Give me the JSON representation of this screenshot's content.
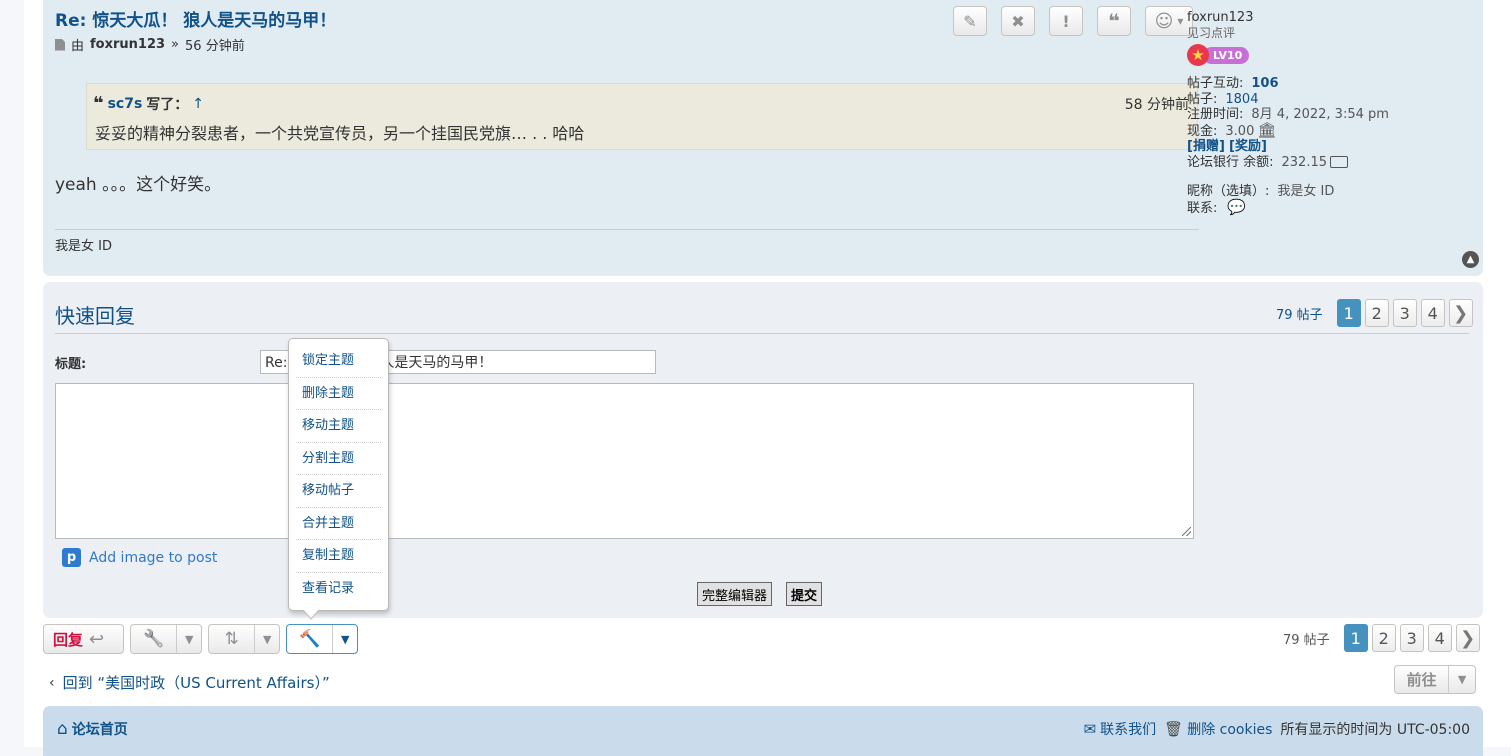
{
  "post": {
    "title": "Re: 惊天大瓜！ 狼人是天马的马甲！",
    "by_prefix": "由",
    "author": "foxrun123",
    "sep": "»",
    "time": "56 分钟前",
    "buttons": {
      "edit_icon": "✎",
      "delete_icon": "✖",
      "report_icon": "!",
      "quote_icon": "❝",
      "react_icon": "☺",
      "react_caret": "▾"
    },
    "quote": {
      "icon": "❝",
      "author": "sc7s",
      "wrote": "写了：",
      "up_arrow": "↑",
      "time": "58 分钟前",
      "body": "妥妥的精神分裂患者，一个共党宣传员，另一个挂国民党旗… .  .  哈哈"
    },
    "body": "yeah 。。。这个好笑。",
    "signature": "我是女 ID",
    "top_icon": "▲"
  },
  "profile": {
    "username": "foxrun123",
    "rank": "见习点评",
    "badge_star": "★",
    "badge_level": "LV10",
    "interactions_label": "帖子互动:",
    "interactions": "106",
    "posts_label": "帖子:",
    "posts": "1804",
    "joined_label": "注册时间:",
    "joined": "8月 4, 2022, 3:54 pm",
    "cash_label": "现金:",
    "cash": "3.00",
    "bank_icon": "🏛",
    "donate": "[捐赠]",
    "reward": "[奖励]",
    "bank_label": "论坛银行 余额:",
    "bank_balance": "232.15",
    "nickname_label": "昵称（选填）:",
    "nickname": "我是女 ID",
    "contact_label": "联系:",
    "contact_icon": "💬"
  },
  "quick_reply": {
    "title": "快速回复",
    "post_count": "79 帖子",
    "pages": [
      "1",
      "2",
      "3",
      "4"
    ],
    "next_icon": "❯",
    "subject_label": "标题:",
    "subject_value": "Re: 惊天大瓜！ 狼人是天马的马甲！",
    "add_image_icon": "p",
    "add_image": "Add image to post",
    "full_editor": "完整编辑器",
    "submit": "提交"
  },
  "mod_menu": {
    "items": [
      "锁定主题",
      "删除主题",
      "移动主题",
      "分割主题",
      "移动帖子",
      "合并主题",
      "复制主题",
      "查看记录"
    ]
  },
  "action_bar": {
    "reply_label": "回复",
    "reply_icon": "↩",
    "tools_icon": "🔧",
    "sort_icon": "⇅",
    "mod_icon": "🔨",
    "caret": "▼",
    "post_count": "79 帖子",
    "pages": [
      "1",
      "2",
      "3",
      "4"
    ],
    "next_icon": "❯"
  },
  "back": {
    "chevron": "‹",
    "label": "回到 “美国时政（US Current Affairs）”"
  },
  "goto": {
    "label": "前往",
    "caret": "▼"
  },
  "footer": {
    "home_icon": "⌂",
    "home": "论坛首页",
    "contact_icon": "✉",
    "contact": "联系我们",
    "cookies_icon": "🗑",
    "cookies": "删除 cookies",
    "timezone": "所有显示的时间为 UTC-05:00"
  },
  "colors": {
    "link": "#105289",
    "post_bg": "#e1ebf2",
    "quote_bg": "#ebeadd",
    "active_page": "#4692bf",
    "reply_red": "#d31141",
    "footer_bg": "#cadceb"
  }
}
